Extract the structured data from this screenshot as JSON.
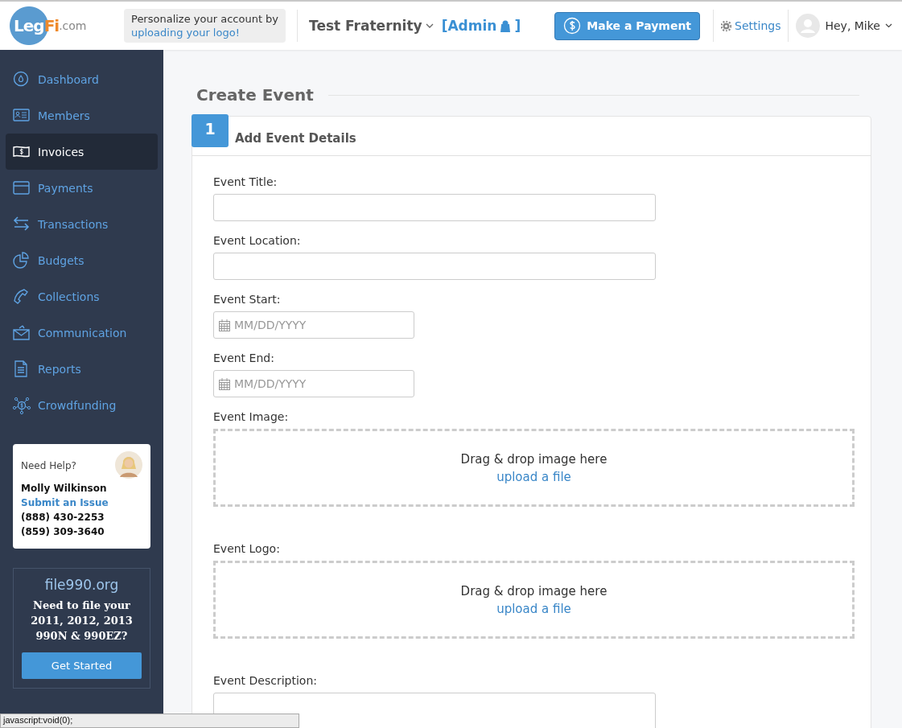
{
  "header": {
    "logo": {
      "main": "Leg",
      "accent": "Fi",
      "suffix": ".com"
    },
    "personalize": {
      "text": "Personalize your account by",
      "link": "uploading your logo!"
    },
    "organization": "Test Fraternity",
    "role_open": "[Admin",
    "role_close": "]",
    "payment_button": "Make a Payment",
    "settings": "Settings",
    "greeting": "Hey, Mike"
  },
  "sidebar": {
    "items": [
      {
        "label": "Dashboard",
        "selected": false
      },
      {
        "label": "Members",
        "selected": false
      },
      {
        "label": "Invoices",
        "selected": true
      },
      {
        "label": "Payments",
        "selected": false
      },
      {
        "label": "Transactions",
        "selected": false
      },
      {
        "label": "Budgets",
        "selected": false
      },
      {
        "label": "Collections",
        "selected": false
      },
      {
        "label": "Communication",
        "selected": false
      },
      {
        "label": "Reports",
        "selected": false
      },
      {
        "label": "Crowdfunding",
        "selected": false
      }
    ],
    "help": {
      "title": "Need Help?",
      "name": "Molly Wilkinson",
      "link": "Submit an Issue",
      "phones": [
        "(888) 430-2253",
        "(859) 309-3640"
      ]
    },
    "promo": {
      "site": "file990.org",
      "text": "Need to file your 2011, 2012, 2013 990N & 990EZ?",
      "button": "Get Started"
    }
  },
  "page": {
    "title": "Create Event",
    "step": {
      "number": "1",
      "title": "Add Event Details"
    },
    "fields": [
      {
        "kind": "text",
        "label": "Event Title:"
      },
      {
        "kind": "text",
        "label": "Event Location:"
      },
      {
        "kind": "date",
        "label": "Event Start:",
        "placeholder": "MM/DD/YYYY"
      },
      {
        "kind": "date",
        "label": "Event End:",
        "placeholder": "MM/DD/YYYY"
      },
      {
        "kind": "dropzone",
        "label": "Event Image:",
        "text": "Drag & drop image here",
        "link": "upload a file"
      },
      {
        "kind": "dropzone",
        "label": "Event Logo:",
        "text": "Drag & drop image here",
        "link": "upload a file"
      },
      {
        "kind": "textarea",
        "label": "Event Description:"
      }
    ]
  },
  "status_bar": "javascript:void(0);"
}
